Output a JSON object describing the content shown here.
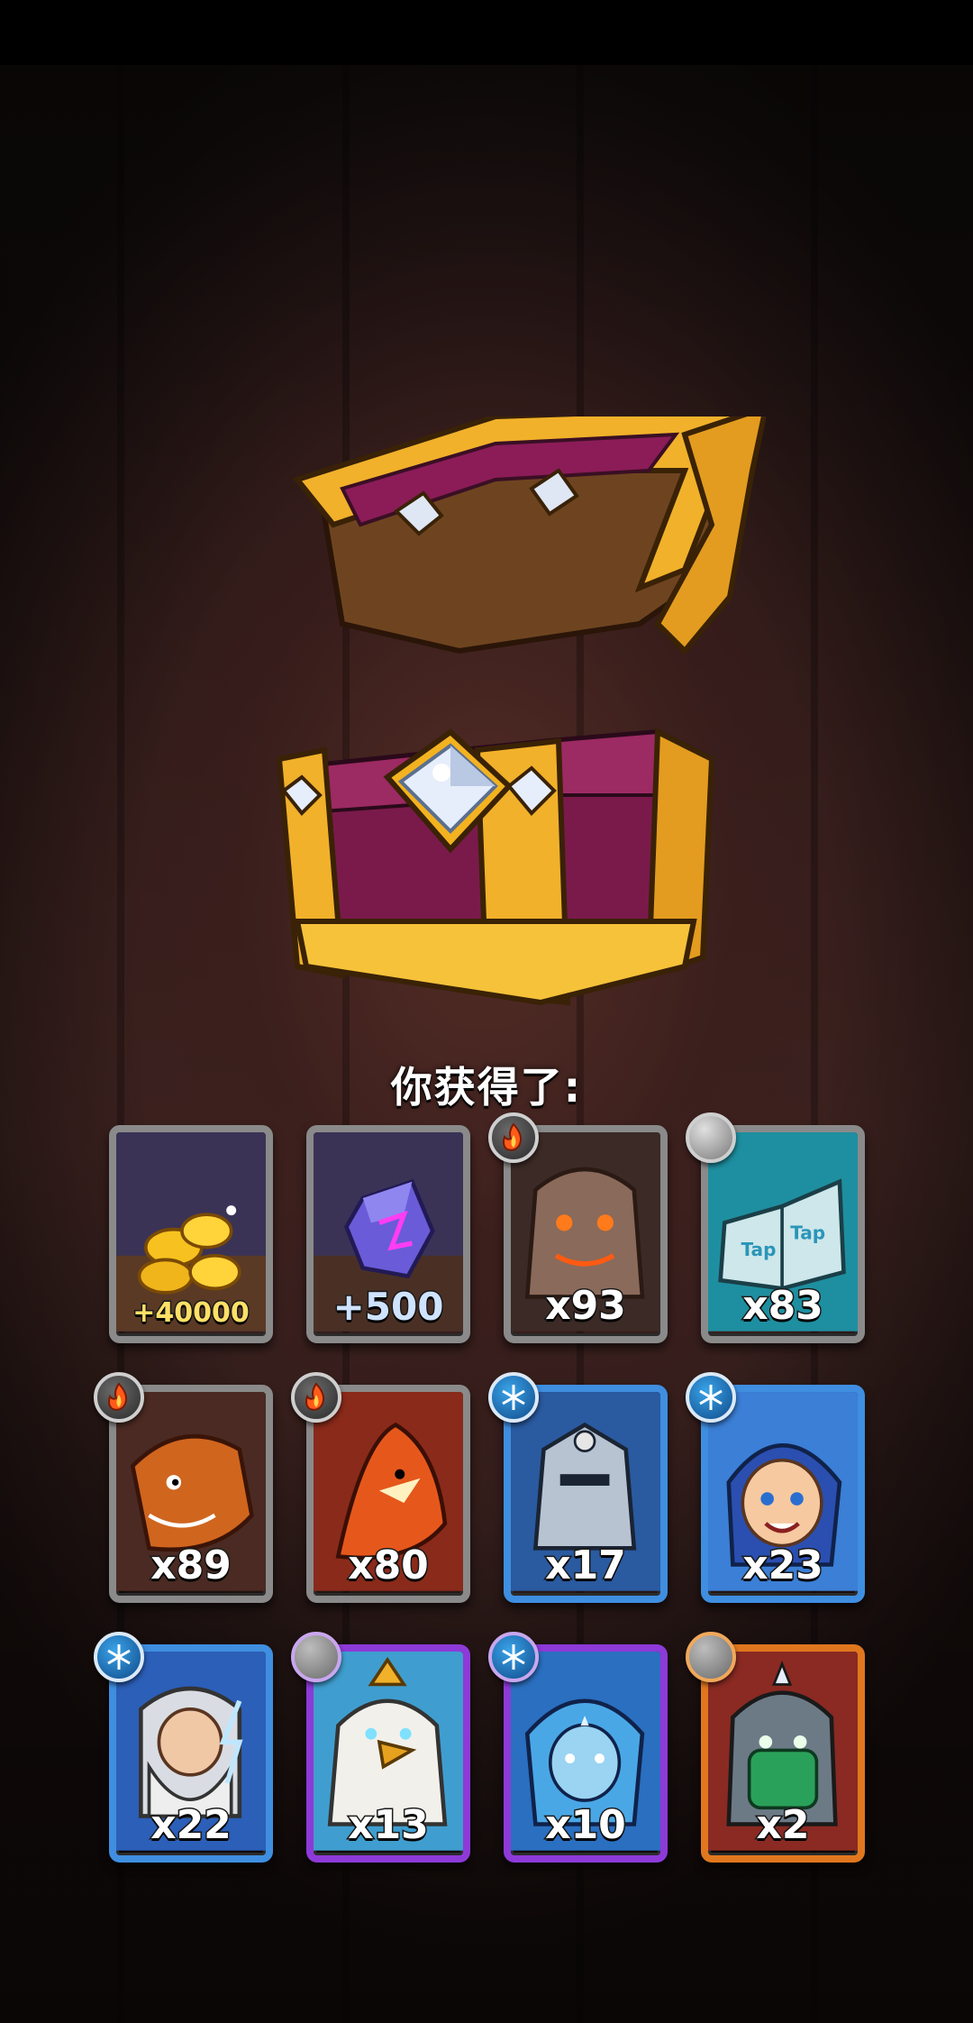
{
  "reward_screen": {
    "title": "你获得了:"
  },
  "rewards": [
    {
      "name": "gold-coins",
      "amount": "+40000",
      "frame": "gray",
      "badge": null
    },
    {
      "name": "purple-gem",
      "amount": "+500",
      "frame": "gray",
      "badge": null
    },
    {
      "name": "stone-golem",
      "amount": "x93",
      "frame": "gray",
      "badge": "fire"
    },
    {
      "name": "taptap-spellbook",
      "amount": "x83",
      "frame": "gray",
      "badge": "stone"
    },
    {
      "name": "orange-dragon",
      "amount": "x89",
      "frame": "gray",
      "badge": "fire"
    },
    {
      "name": "fire-fox",
      "amount": "x80",
      "frame": "gray",
      "badge": "fire"
    },
    {
      "name": "skull-knight",
      "amount": "x17",
      "frame": "blue",
      "badge": "ice"
    },
    {
      "name": "blue-hair-girl",
      "amount": "x23",
      "frame": "blue",
      "badge": "ice"
    },
    {
      "name": "thunder-wizard",
      "amount": "x22",
      "frame": "blue",
      "badge": "ice"
    },
    {
      "name": "griffin-king",
      "amount": "x13",
      "frame": "purple",
      "badge": "stone"
    },
    {
      "name": "frost-elf",
      "amount": "x10",
      "frame": "purple",
      "badge": "ice"
    },
    {
      "name": "jade-warrior",
      "amount": "x2",
      "frame": "orange",
      "badge": "stone"
    }
  ]
}
